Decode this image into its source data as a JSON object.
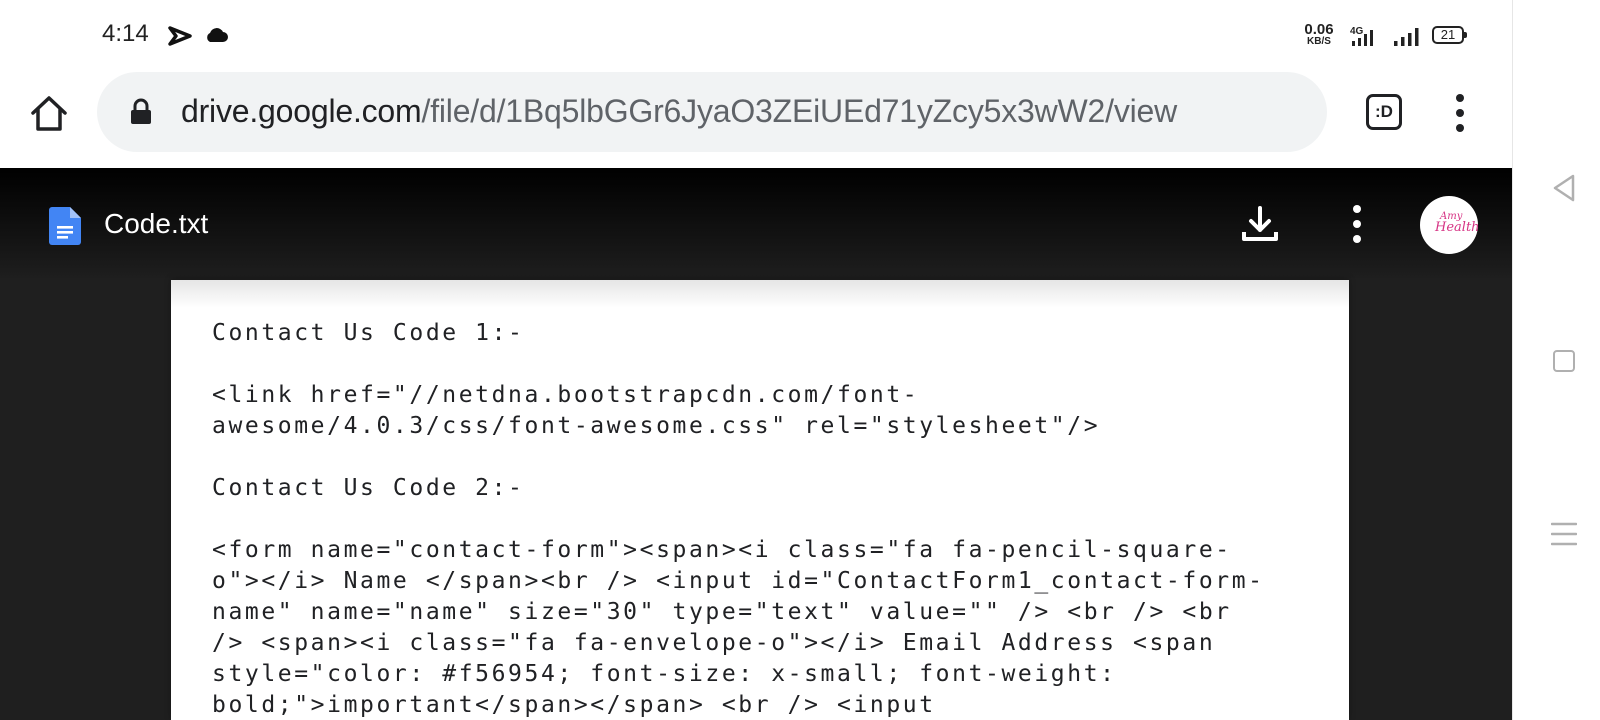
{
  "status_bar": {
    "time": "4:14",
    "net_speed_value": "0.06",
    "net_speed_unit": "KB/S",
    "network_label": "4G",
    "battery_level": "21",
    "icons": [
      "send-app-icon",
      "cloud-icon",
      "signal-4g-icon",
      "signal-icon",
      "battery-icon"
    ]
  },
  "browser": {
    "url_host": "drive.google.com",
    "url_path": "/file/d/1Bq5lbGGr6JyaO3ZEiUEd71yZcy5x3wW2/view",
    "tab_switcher_label": ":D",
    "icons": [
      "home-icon",
      "lock-icon",
      "more-vert-icon"
    ]
  },
  "viewer": {
    "file_name": "Code.txt",
    "icons": [
      "google-docs-icon",
      "download-icon",
      "more-vert-icon"
    ],
    "avatar": {
      "line1": "Amy",
      "line2": "Health",
      "accent_color": "#d63384"
    },
    "document_text": "Contact Us Code 1:-\n\n<link href=\"//netdna.bootstrapcdn.com/font-\nawesome/4.0.3/css/font-awesome.css\" rel=\"stylesheet\"/>\n\nContact Us Code 2:-\n\n<form name=\"contact-form\"><span><i class=\"fa fa-pencil-square-\no\"></i> Name </span><br /> <input id=\"ContactForm1_contact-form-\nname\" name=\"name\" size=\"30\" type=\"text\" value=\"\" /> <br /> <br\n/> <span><i class=\"fa fa-envelope-o\"></i> Email Address <span\nstyle=\"color: #f56954; font-size: x-small; font-weight:\nbold;\">important</span></span> <br /> <input"
  },
  "nav_bar": {
    "icons": [
      "back-icon",
      "home-square-icon",
      "recents-icon"
    ]
  },
  "colors": {
    "viewer_background": "#1f1f1f",
    "omnibox_background": "#f1f3f4",
    "docs_blue": "#4285f4"
  }
}
